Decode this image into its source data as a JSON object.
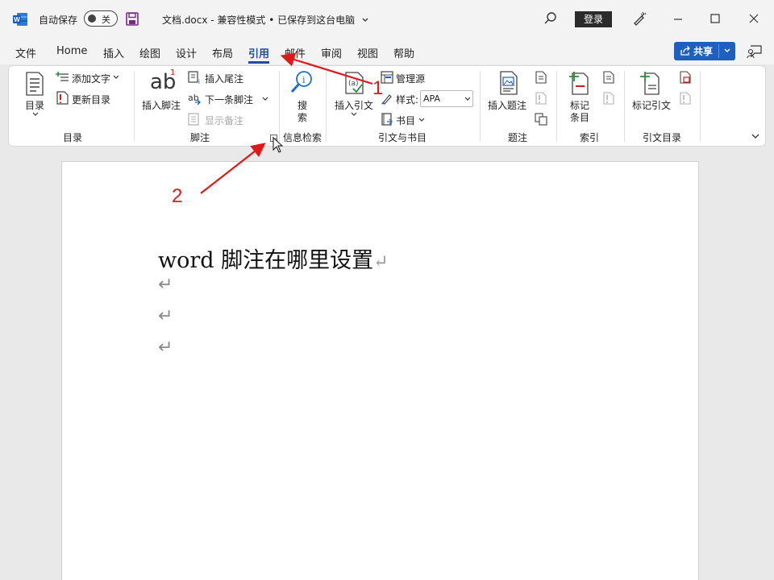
{
  "titlebar": {
    "autosave_label": "自动保存",
    "toggle_state": "关",
    "doc_title": "文档.docx  -  兼容性模式 • 已保存到这台电脑",
    "login_label": "登录",
    "chevron": "⌄"
  },
  "tabs": [
    "文件",
    "Home",
    "插入",
    "绘图",
    "设计",
    "布局",
    "引用",
    "邮件",
    "审阅",
    "视图",
    "帮助"
  ],
  "active_tab": "引用",
  "share": {
    "label": "共享"
  },
  "ribbon": {
    "toc": {
      "big_label": "目录",
      "add_text": "添加文字",
      "update_toc": "更新目录",
      "group": "目录"
    },
    "footnotes": {
      "ab_text": "ab",
      "sup": "1",
      "insert_footnote": "插入脚注",
      "insert_endnote": "插入尾注",
      "next_footnote": "下一条脚注",
      "show_notes": "显示备注",
      "group": "脚注"
    },
    "research": {
      "search_l1": "搜",
      "search_l2": "索",
      "group": "信息检索"
    },
    "citations": {
      "insert_citation": "插入引文",
      "manage_sources": "管理源",
      "style_label": "样式:",
      "style_value": "APA",
      "bibliography": "书目",
      "group": "引文与书目"
    },
    "captions": {
      "insert_caption": "插入题注",
      "group": "题注"
    },
    "index": {
      "mark_entry_l1": "标记",
      "mark_entry_l2": "条目",
      "group": "索引"
    },
    "toa": {
      "mark_citation": "标记引文",
      "group": "引文目录"
    }
  },
  "document": {
    "heading": "word 脚注在哪里设置",
    "para_mark": "↵"
  },
  "annotations": {
    "one": "1",
    "two": "2",
    "color": "#e21818"
  }
}
